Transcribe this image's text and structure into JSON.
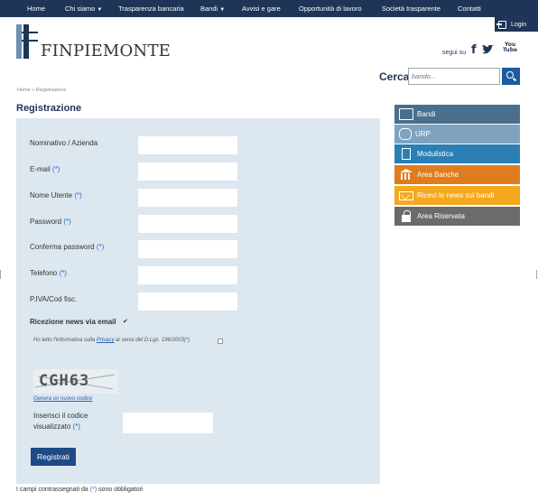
{
  "nav": {
    "items": [
      {
        "label": "Home",
        "caret": ""
      },
      {
        "label": "Chi siamo",
        "caret": "▼"
      },
      {
        "label": "Trasparenza bancaria",
        "caret": ""
      },
      {
        "label": "Bandi",
        "caret": "▼"
      },
      {
        "label": "Avvisi e gare",
        "caret": ""
      },
      {
        "label": "Opportunità di lavoro",
        "caret": ""
      },
      {
        "label": "Società trasparente",
        "caret": ""
      },
      {
        "label": "Contatti",
        "caret": ""
      }
    ],
    "login_label": "Login"
  },
  "brand": {
    "name": "FINPIEMONTE",
    "follow_label": "segui su",
    "youtube_glyph": "You\nTube"
  },
  "search": {
    "label": "Cerca",
    "placeholder": "bando..."
  },
  "breadcrumb": {
    "home": "Home",
    "separator": "»",
    "current": "Registrazione"
  },
  "page": {
    "title": "Registrazione"
  },
  "form": {
    "fields": [
      {
        "label": "Nominativo / Azienda",
        "required": ""
      },
      {
        "label": "E-mail",
        "required": "(*)"
      },
      {
        "label": "Nome Utente",
        "required": "(*)"
      },
      {
        "label": "Password",
        "required": "(*)"
      },
      {
        "label": "Conferma password",
        "required": "(*)"
      },
      {
        "label": "Telefono",
        "required": "(*)"
      },
      {
        "label": "P.IVA/Cod fisc.",
        "required": ""
      }
    ],
    "news_label": "Ricezione news via email",
    "news_checked_glyph": "✔",
    "privacy_prefix": "Ho letto l'informativa sulla ",
    "privacy_link": "Privacy",
    "privacy_suffix": " ai sensi del D.Lgs. 196/2003",
    "privacy_req": "(*)",
    "captcha_text": "CGH63",
    "regen_label": "Genera un nuovo codice",
    "code_label_line1": "Inserisci il codice",
    "code_label_line2": "visualizzato",
    "code_req": "(*)",
    "submit_label": "Registrati",
    "footnote_prefix": "I campi contrassegnati da ",
    "footnote_req": "(*)",
    "footnote_suffix": " sono obbligatori"
  },
  "sidebar": {
    "items": [
      {
        "label": "Bandi",
        "color": "#4a6f8d",
        "icon": "folder-icon"
      },
      {
        "label": "URP",
        "color": "#7fa3bf",
        "icon": "people-icon"
      },
      {
        "label": "Modulistica",
        "color": "#2b7fb4",
        "icon": "document-icon"
      },
      {
        "label": "Area Banche",
        "color": "#e07b1e",
        "icon": "bank-icon"
      },
      {
        "label": "Ricevi le news sui bandi",
        "color": "#f4a81e",
        "icon": "mail-icon"
      },
      {
        "label": "Area Riservata",
        "color": "#6b6b6b",
        "icon": "lock-icon"
      }
    ]
  },
  "colors": {
    "nav_bg": "#1e3557",
    "panel_bg": "#dde7f0",
    "required": "#2a6fc9",
    "submit_bg": "#1e4a85"
  }
}
